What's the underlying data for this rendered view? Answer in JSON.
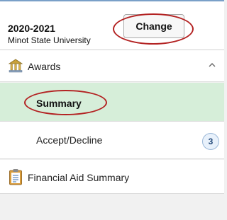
{
  "header": {
    "year": "2020-2021",
    "institution": "Minot State University",
    "change_label": "Change"
  },
  "nav": {
    "awards": {
      "label": "Awards",
      "icon": "bank-icon",
      "expanded": true
    },
    "summary": {
      "label": "Summary",
      "selected": true
    },
    "accept_decline": {
      "label": "Accept/Decline",
      "badge": "3"
    },
    "financial_aid_summary": {
      "label": "Financial Aid Summary",
      "icon": "clipboard-icon"
    }
  },
  "colors": {
    "selected_bg": "#d6eed9",
    "annotation": "#b32222",
    "badge_border": "#9bb8d8"
  }
}
